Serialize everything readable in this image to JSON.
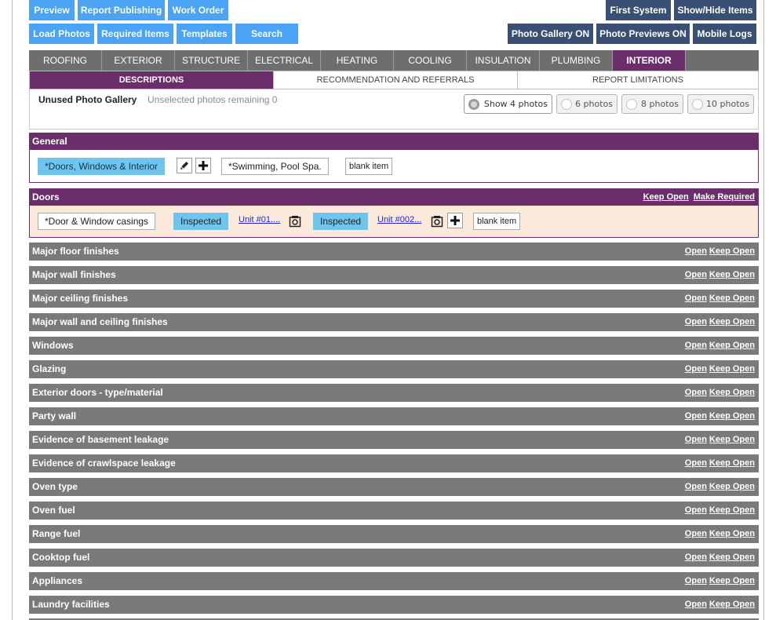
{
  "toolbar": {
    "row1_left": [
      "Preview",
      "Report Publishing",
      "Work Order"
    ],
    "row1_right": [
      "First System",
      "Show/Hide Items"
    ],
    "row2_left": [
      "Load Photos",
      "Required Items",
      "Templates",
      "Search"
    ],
    "row2_right": [
      "Photo Gallery ON",
      "Photo Previews ON",
      "Mobile Logs"
    ]
  },
  "system_tabs": [
    "ROOFING",
    "EXTERIOR",
    "STRUCTURE",
    "ELECTRICAL",
    "HEATING",
    "COOLING",
    "INSULATION",
    "PLUMBING",
    "INTERIOR"
  ],
  "active_system_tab": "INTERIOR",
  "sub_tabs": [
    "DESCRIPTIONS",
    "RECOMMENDATION AND REFERRALS",
    "REPORT LIMITATIONS"
  ],
  "active_sub_tab": "DESCRIPTIONS",
  "gallery": {
    "title": "Unused Photo Gallery",
    "subtitle": "Unselected photos remaining 0",
    "options": [
      "Show 4 photos",
      "6 photos",
      "8 photos",
      "10 photos"
    ],
    "selected": "Show 4 photos"
  },
  "general": {
    "title": "General",
    "selected_item": "*Doors, Windows & Interior",
    "item2": "*Swimming, Pool Spa.",
    "blank": "blank item"
  },
  "doors": {
    "title": "Doors",
    "keep_open": "Keep Open",
    "make_required": "Make Required",
    "item": "*Door & Window casings",
    "inspected_1": "Inspected",
    "unit_1": "Unit #01....",
    "inspected_2": "Inspected",
    "unit_2": "Unit #002...",
    "blank": "blank item"
  },
  "row_links": {
    "open": "Open",
    "keep_open": "Keep Open"
  },
  "rows": [
    "Major floor finishes",
    "Major wall finishes",
    "Major ceiling finishes",
    "Major wall and ceiling finishes",
    "Windows",
    "Glazing",
    "Exterior doors - type/material",
    "Party wall",
    "Evidence of basement leakage",
    "Evidence of crawlspace leakage",
    "Oven type",
    "Oven fuel",
    "Range fuel",
    "Cooktop fuel",
    "Appliances",
    "Laundry facilities"
  ],
  "colors": {
    "accent_purple": "#6b2d6b",
    "button_blue": "#4aa3f5",
    "button_navy": "#3a4f74",
    "row_gray": "#7a7a7a",
    "item_cyan": "#6ec6ef"
  }
}
